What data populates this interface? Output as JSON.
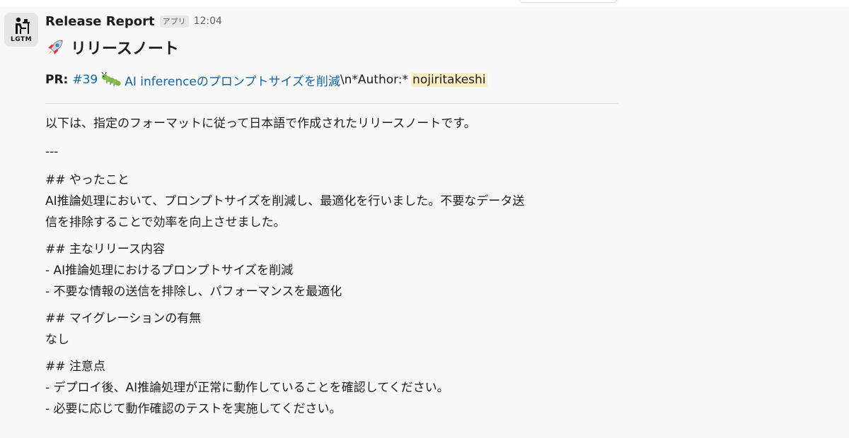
{
  "message": {
    "sender": "Release Report",
    "badge": "アプリ",
    "time": "12:04",
    "avatar_text": "LGTM",
    "title": "リリースノート",
    "title_icon": "rocket-icon",
    "pr": {
      "label": "PR:",
      "number": "#39",
      "icon": "caterpillar-icon",
      "link_text": "AI inferenceのプロンプトサイズを削減",
      "suffix": "\\n*Author:*",
      "author": "nojiritakeshi"
    },
    "body": {
      "intro": "以下は、指定のフォーマットに従って日本語で作成されたリリースノートです。",
      "separator": "---",
      "sections": [
        {
          "heading": "## やったこと",
          "lines": [
            "AI推論処理において、プロンプトサイズを削減し、最適化を行いました。不要なデータ送",
            "信を排除することで効率を向上させました。"
          ]
        },
        {
          "heading": "## 主なリリース内容",
          "lines": [
            "- AI推論処理におけるプロンプトサイズを削減",
            "- 不要な情報の送信を排除し、パフォーマンスを最適化"
          ]
        },
        {
          "heading": "## マイグレーションの有無",
          "lines": [
            "なし"
          ]
        },
        {
          "heading": "## 注意点",
          "lines": [
            "- デプロイ後、AI推論処理が正常に動作していることを確認してください。",
            "- 必要に応じて動作確認のテストを実施してください。"
          ]
        }
      ]
    },
    "colors": {
      "link": "#1264a3",
      "mention_bg": "#fbefc6",
      "message_bg": "#f8f8f8"
    }
  }
}
